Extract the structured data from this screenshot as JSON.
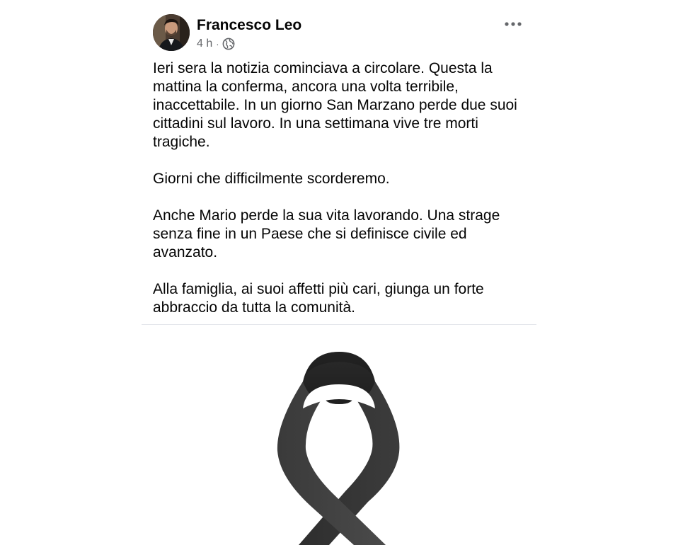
{
  "post": {
    "author": "Francesco Leo",
    "timestamp": "4 h",
    "separator": "·",
    "audience_icon": "globe-icon",
    "more_icon": "more-options-icon",
    "paragraphs": [
      "Ieri sera la notizia cominciava a circolare. Questa la mattina la conferma, ancora una volta terribile, inaccettabile. In un giorno San Marzano perde due suoi cittadini sul lavoro. In una settimana vive tre morti tragiche.",
      "Giorni che difficilmente scorderemo.",
      "Anche Mario perde la sua vita lavorando. Una strage senza fine in un Paese che si definisce civile ed avanzato.",
      "Alla famiglia, ai suoi affetti più cari, giunga un forte abbraccio da tutta la comunità."
    ],
    "media": "black-mourning-ribbon"
  },
  "colors": {
    "text": "#050505",
    "secondary_text": "#65676b",
    "ribbon_dark": "#2b2b2b",
    "ribbon_light": "#3d3d3d"
  }
}
